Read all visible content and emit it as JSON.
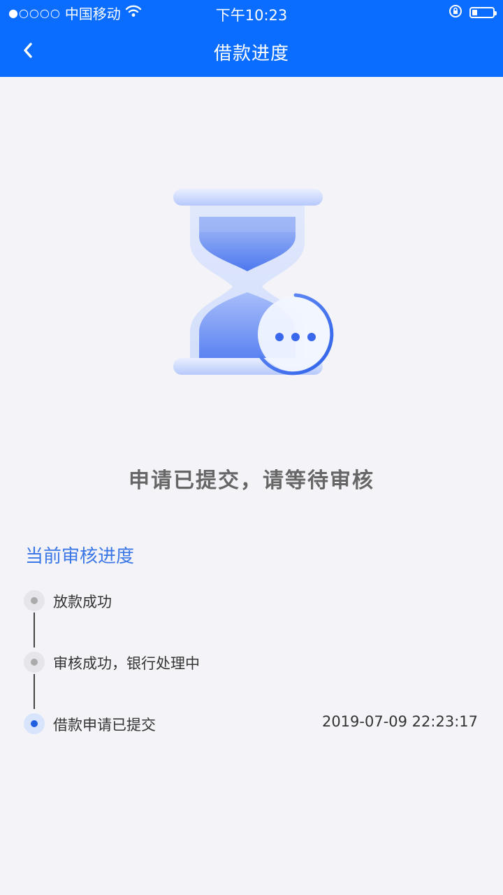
{
  "status_bar": {
    "signal_dots": "●○○○○",
    "carrier": "中国移动",
    "time": "下午10:23"
  },
  "nav": {
    "title": "借款进度"
  },
  "headline": "申请已提交，请等待审核",
  "progress": {
    "section_title": "当前审核进度",
    "steps": [
      {
        "label": "放款成功",
        "time": "",
        "state": "pending"
      },
      {
        "label": "审核成功，银行处理中",
        "time": "",
        "state": "pending"
      },
      {
        "label": "借款申请已提交",
        "time": "2019-07-09 22:23:17",
        "state": "active"
      }
    ]
  },
  "colors": {
    "primary": "#0a6dff",
    "section_title": "#3b77e6",
    "active_dot": "#1f5fe0",
    "background": "#f4f4f8"
  },
  "icons": [
    "back-arrow-icon",
    "wifi-icon",
    "rotation-lock-icon",
    "battery-icon",
    "hourglass-icon",
    "pending-dots-icon"
  ]
}
